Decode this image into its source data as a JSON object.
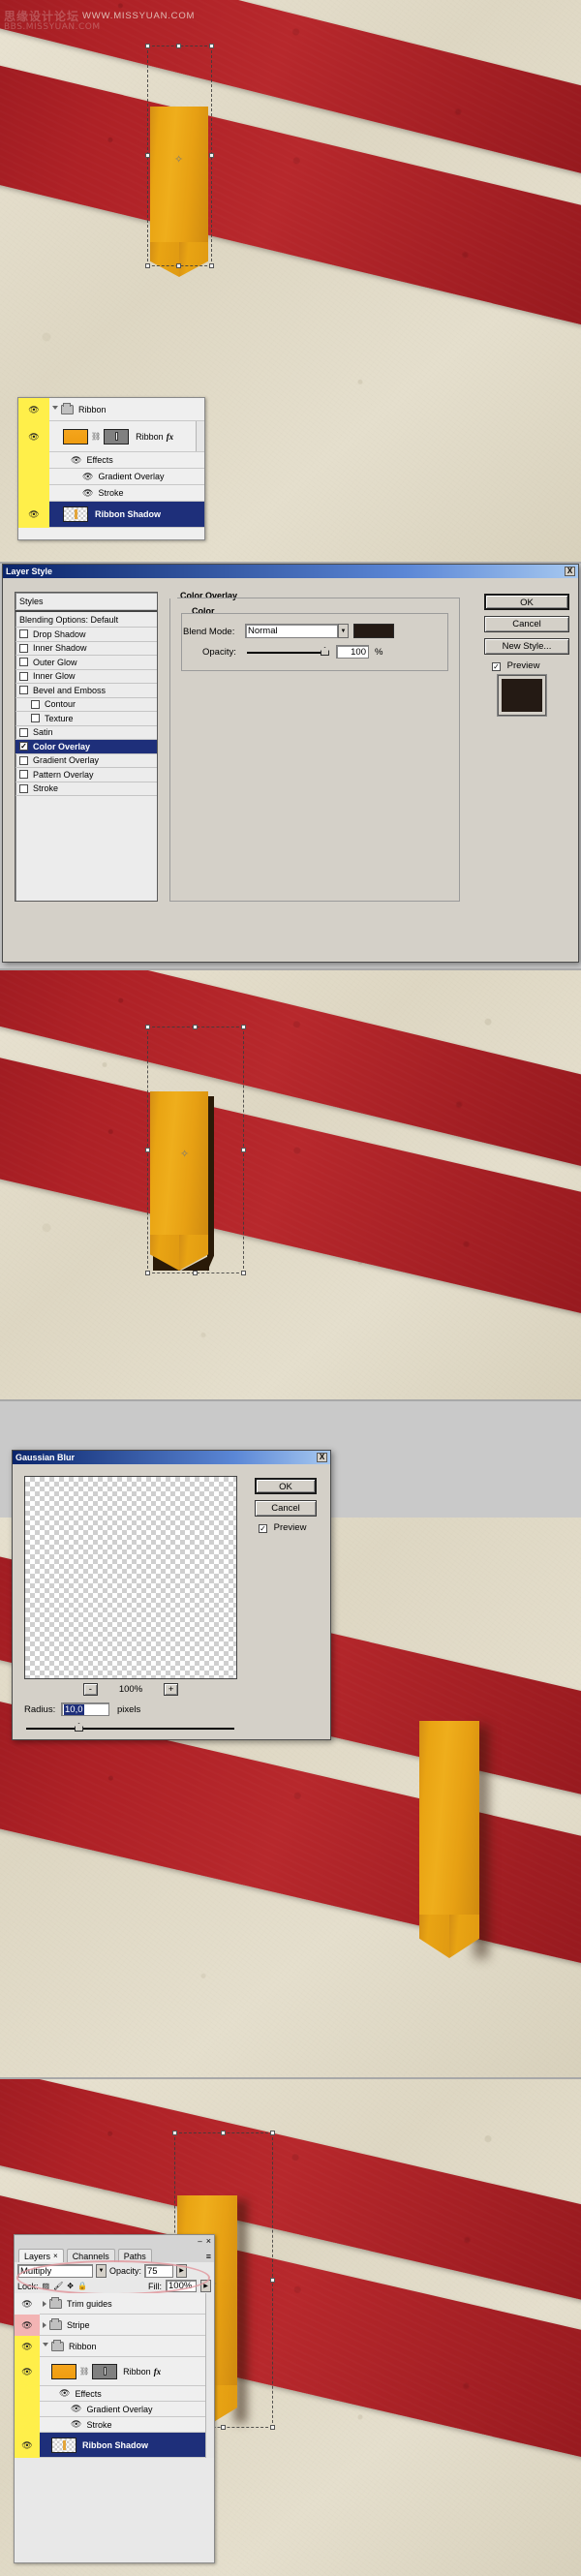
{
  "watermark": {
    "cn": "思缘设计论坛",
    "bbs": "BBS.MISSYUAN.COM",
    "url": "WWW.MISSYUAN.COM"
  },
  "panel1": {
    "layers_panel": {
      "name": "layers-panel",
      "rows": [
        {
          "kind": "group",
          "label": "Ribbon",
          "eye": "visible",
          "eye_highlight": "yellow",
          "disclosure": "open"
        },
        {
          "kind": "layer",
          "label": "Ribbon",
          "eye": "visible",
          "eye_highlight": "yellow",
          "fx": "fx",
          "thumb": "orange",
          "mask": "mask"
        },
        {
          "kind": "effects",
          "label": "Effects",
          "eye": "visible"
        },
        {
          "kind": "effect",
          "label": "Gradient Overlay",
          "eye": "visible"
        },
        {
          "kind": "effect",
          "label": "Stroke",
          "eye": "visible"
        },
        {
          "kind": "layer",
          "label": "Ribbon Shadow",
          "eye": "visible",
          "eye_highlight": "yellow",
          "selected": true,
          "thumb": "checker"
        }
      ]
    }
  },
  "layer_style": {
    "title": "Layer Style",
    "close_label": "X",
    "styles_list": [
      {
        "label": "Styles",
        "type": "header"
      },
      {
        "label": "Blending Options: Default",
        "type": "header"
      },
      {
        "label": "Drop Shadow",
        "type": "check",
        "checked": false
      },
      {
        "label": "Inner Shadow",
        "type": "check",
        "checked": false
      },
      {
        "label": "Outer Glow",
        "type": "check",
        "checked": false
      },
      {
        "label": "Inner Glow",
        "type": "check",
        "checked": false
      },
      {
        "label": "Bevel and Emboss",
        "type": "check",
        "checked": false
      },
      {
        "label": "Contour",
        "type": "check",
        "checked": false,
        "indent": true
      },
      {
        "label": "Texture",
        "type": "check",
        "checked": false,
        "indent": true
      },
      {
        "label": "Satin",
        "type": "check",
        "checked": false
      },
      {
        "label": "Color Overlay",
        "type": "check",
        "checked": true,
        "active": true
      },
      {
        "label": "Gradient Overlay",
        "type": "check",
        "checked": false
      },
      {
        "label": "Pattern Overlay",
        "type": "check",
        "checked": false
      },
      {
        "label": "Stroke",
        "type": "check",
        "checked": false
      }
    ],
    "section_title": "Color Overlay",
    "group_title": "Color",
    "blend_mode_label": "Blend Mode:",
    "blend_mode_value": "Normal",
    "opacity_label": "Opacity:",
    "opacity_value": "100",
    "percent": "%",
    "color_swatch": "#241a14",
    "preview_swatch": "#241a14",
    "buttons": {
      "ok": "OK",
      "cancel": "Cancel",
      "new_style": "New Style...",
      "preview": "Preview",
      "preview_checked": true
    }
  },
  "gaussian_blur": {
    "title": "Gaussian Blur",
    "close_label": "X",
    "ok": "OK",
    "cancel": "Cancel",
    "preview": "Preview",
    "preview_checked": true,
    "zoom_minus": "-",
    "zoom_level": "100%",
    "zoom_plus": "+",
    "radius_label": "Radius:",
    "radius_value": "10,0",
    "radius_units": "pixels"
  },
  "panel4": {
    "layers_panel": {
      "tabs": [
        {
          "label": "Layers",
          "active": true,
          "close": "×"
        },
        {
          "label": "Channels",
          "active": false
        },
        {
          "label": "Paths",
          "active": false
        }
      ],
      "menu_icon": "panel-menu-icon",
      "minimize": "–",
      "close": "×",
      "blend_mode": "Multiply",
      "opacity_label": "Opacity:",
      "opacity_value": "75",
      "lock_label": "Lock:",
      "lock_icons": [
        "lock-transparent-icon",
        "lock-image-icon",
        "lock-position-icon",
        "lock-all-icon"
      ],
      "fill_label": "Fill:",
      "fill_value": "100%",
      "rows": [
        {
          "kind": "group",
          "label": "Trim guides",
          "eye": "visible",
          "disclosure": "closed"
        },
        {
          "kind": "group",
          "label": "Stripe",
          "eye": "visible",
          "eye_highlight": "pink",
          "disclosure": "closed"
        },
        {
          "kind": "group",
          "label": "Ribbon",
          "eye": "visible",
          "eye_highlight": "yellow",
          "disclosure": "open"
        },
        {
          "kind": "layer",
          "label": "Ribbon",
          "eye": "visible",
          "eye_highlight": "yellow",
          "fx": "fx",
          "thumb": "orange",
          "mask": "mask"
        },
        {
          "kind": "effects",
          "label": "Effects",
          "eye": "visible"
        },
        {
          "kind": "effect",
          "label": "Gradient Overlay",
          "eye": "visible"
        },
        {
          "kind": "effect",
          "label": "Stroke",
          "eye": "visible"
        },
        {
          "kind": "layer",
          "label": "Ribbon Shadow",
          "eye": "visible",
          "eye_highlight": "yellow",
          "selected": true,
          "thumb": "checker"
        }
      ]
    }
  }
}
